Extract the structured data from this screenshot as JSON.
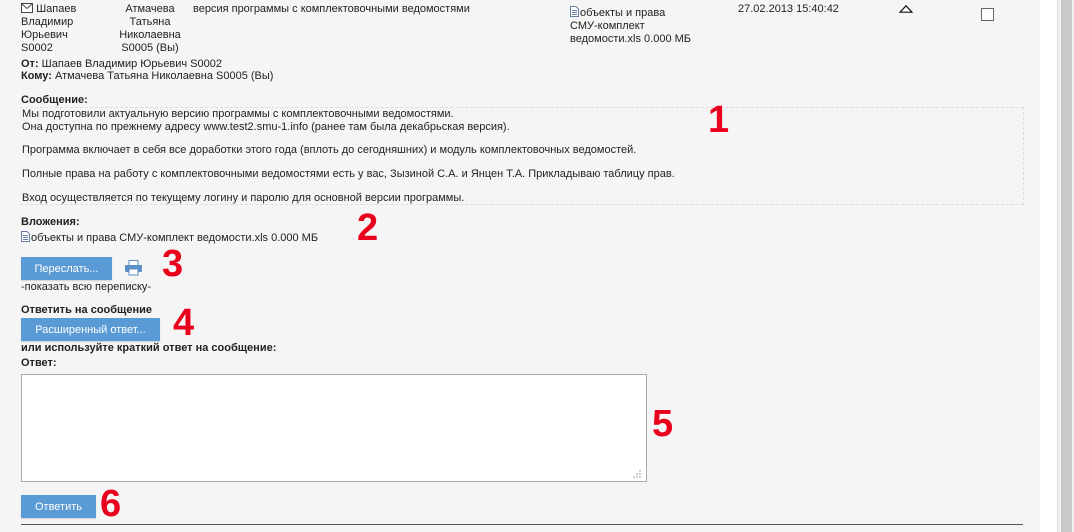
{
  "header": {
    "from_name_lines": [
      "Шапаев",
      "Владимир",
      "Юрьевич",
      "S0002"
    ],
    "to_name_lines": [
      "Атмачева",
      "Татьяна",
      "Николаевна",
      "S0005 (Вы)"
    ],
    "subject": "версия программы с комплектовочными ведомостями",
    "attachment_lines": [
      "объекты и права",
      "СМУ-комплект",
      "ведомости.xls 0.000 МБ"
    ],
    "datetime": "27.02.2013 15:40:42"
  },
  "meta": {
    "from_label": "От:",
    "from_value": "Шапаев Владимир Юрьевич S0002",
    "to_label": "Кому:",
    "to_value": "Атмачева Татьяна Николаевна S0005 (Вы)"
  },
  "message": {
    "label": "Сообщение:",
    "lines": [
      "Мы подготовили актуальную версию программы с комплектовочными ведомостями.",
      "Она доступна по прежнему адресу www.test2.smu-1.info (ранее там была декабрьская версия).",
      "Программа включает в себя все доработки этого года (вплоть до сегодняшних) и модуль комплектовочных ведомостей.",
      "Полные права на работу с комплектовочными ведомостями есть у вас, Зызиной С.А. и Янцен Т.А. Прикладываю таблицу прав.",
      "Вход осуществляется по текущему логину и паролю для основной версии программы."
    ]
  },
  "attachments": {
    "label": "Вложения:",
    "file": "объекты и права СМУ-комплект ведомости.xls 0.000 МБ"
  },
  "actions": {
    "forward_button": "Переслать...",
    "show_all": "-показать всю переписку-",
    "reply_heading": "Ответить на сообщение",
    "extended_reply_button": "Расширенный ответ...",
    "short_reply_hint": "или используйте краткий ответ на сообщение:",
    "answer_label": "Ответ:",
    "reply_button": "Ответить"
  },
  "annotations": [
    "1",
    "2",
    "3",
    "4",
    "5",
    "6"
  ],
  "colors": {
    "button": "#5b9bd5",
    "annotation": "#e8001c",
    "panel": "#f5f5f5"
  },
  "icons": [
    "envelope-icon",
    "file-icon",
    "printer-icon",
    "collapse-arrow-icon",
    "resize-grip-icon"
  ]
}
